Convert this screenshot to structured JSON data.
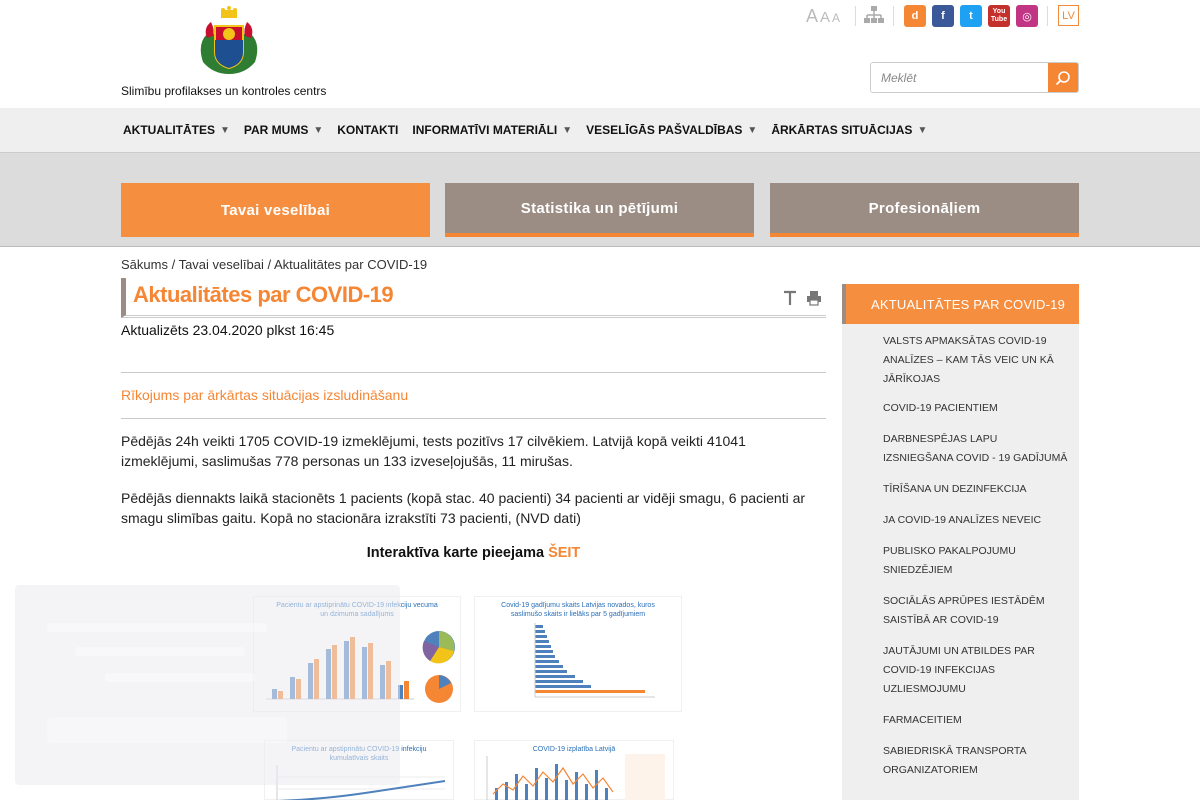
{
  "header": {
    "org_name": "Slimību profilakses un kontroles centrs",
    "font_sizes": [
      "A",
      "A",
      "A"
    ],
    "social": [
      {
        "name": "draugiem-icon",
        "glyph": "d",
        "color": "#f58634"
      },
      {
        "name": "facebook-icon",
        "glyph": "f",
        "color": "#3b5998"
      },
      {
        "name": "twitter-icon",
        "glyph": "t",
        "color": "#1da1f2"
      },
      {
        "name": "youtube-icon",
        "glyph": "You Tube",
        "color": "#c4302b"
      },
      {
        "name": "instagram-icon",
        "glyph": "◎",
        "color": "#c13584"
      }
    ],
    "lang": "LV",
    "search_placeholder": "Meklēt"
  },
  "nav": [
    {
      "label": "AKTUALITĀTES",
      "caret": true
    },
    {
      "label": "PAR MUMS",
      "caret": true
    },
    {
      "label": "KONTAKTI",
      "caret": false
    },
    {
      "label": "INFORMATĪVI MATERIĀLI",
      "caret": true
    },
    {
      "label": "VESELĪGĀS PAŠVALDĪBAS",
      "caret": true
    },
    {
      "label": "ĀRKĀRTAS SITUĀCIJAS",
      "caret": true
    }
  ],
  "tiles": [
    "Tavai veselībai",
    "Statistika un pētījumi",
    "Profesionāļiem"
  ],
  "breadcrumb": [
    "Sākums",
    "Tavai veselībai",
    "Aktualitātes par COVID-19"
  ],
  "page": {
    "title": "Aktualitātes par COVID-19",
    "updated": "Aktualizēts 23.04.2020 plkst 16:45",
    "order_link": "Rīkojums par ārkārtas situācijas izsludināšanu",
    "para1": "Pēdējās 24h veikti 1705 COVID-19 izmeklējumi, tests pozitīvs 17 cilvēkiem. Latvijā kopā veikti 41041 izmeklējumi, saslimušas 778 personas un 133 izveseļojušās, 11 mirušas.",
    "para2": "Pēdējās diennakts laikā stacionēts 1 pacients (kopā stac. 40 pacienti) 34 pacienti ar vidēji smagu, 6 pacienti ar smagu slimības gaitu. Kopā no stacionāra izrakstīti 73 pacienti, (NVD dati)",
    "map_text": "Interaktīva karte pieejama",
    "map_link": "ŠEIT"
  },
  "thumbs": [
    {
      "caption": "Pacientu ar apstiprinātu COVID-19 infekciju vecuma un dzimuma sadalījums"
    },
    {
      "caption": "Covid-19 gadījumu skaits Latvijas novados, kuros saslimušo skaits ir lielāks par 5 gadījumiem"
    },
    {
      "caption": "Pacientu ar apstiprinātu COVID-19 infekciju kumulatīvais skaits"
    },
    {
      "caption": "COVID-19 izplatība Latvijā"
    }
  ],
  "sidebar": {
    "head": "AKTUALITĀTES PAR COVID-19",
    "items": [
      "VALSTS APMAKSĀTAS COVID-19 ANALĪZES – KAM TĀS VEIC UN KĀ JĀRĪKOJAS",
      "COVID-19 PACIENTIEM",
      "DARBNESPĒJAS LAPU IZSNIEGŠANA COVID - 19 GADĪJUMĀ",
      "TĪRĪŠANA UN DEZINFEKCIJA",
      "JA COVID-19 ANALĪZES NEVEIC",
      "PUBLISKO PAKALPOJUMU SNIEDZĒJIEM",
      "SOCIĀLĀS APRŪPES IESTĀDĒM SAISTĪBĀ AR COVID-19",
      "JAUTĀJUMI UN ATBILDES PAR COVID-19 INFEKCIJAS UZLIESMOJUMU",
      "FARMACEITIEM",
      "SABIEDRISKĀ TRANSPORTA ORGANIZATORIEM"
    ]
  },
  "colors": {
    "accent": "#f58634",
    "taupe": "#9b8d84",
    "nav_bg": "#efefef",
    "banner_bg": "#dcdcdc"
  }
}
